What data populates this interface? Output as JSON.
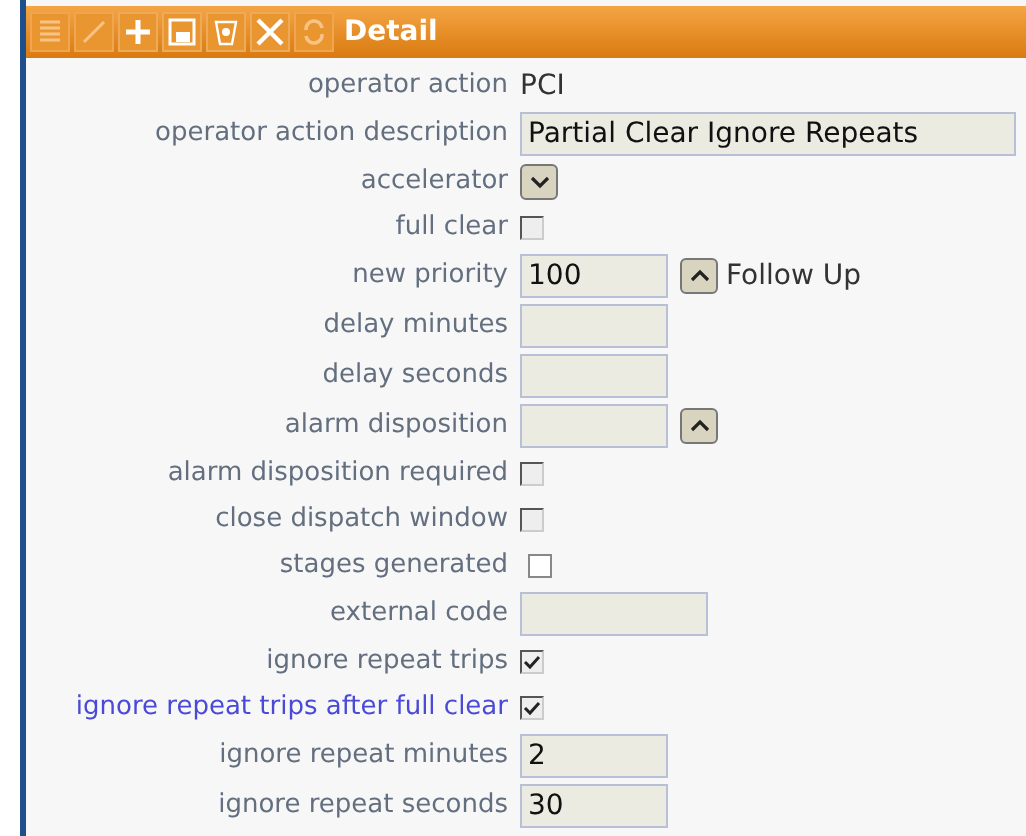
{
  "toolbar": [
    {
      "kind": "list",
      "disabled": true
    },
    {
      "kind": "edit",
      "disabled": true
    },
    {
      "kind": "add",
      "disabled": false
    },
    {
      "kind": "save",
      "disabled": false
    },
    {
      "kind": "delete",
      "disabled": false
    },
    {
      "kind": "close",
      "disabled": false
    },
    {
      "kind": "refresh",
      "disabled": true
    }
  ],
  "title": "Detail",
  "fields": [
    {
      "label": "operator action",
      "kind": "text",
      "value": "PCI"
    },
    {
      "label": "operator action description",
      "kind": "longfield",
      "value": "Partial Clear Ignore Repeats"
    },
    {
      "label": "accelerator",
      "kind": "dropdown"
    },
    {
      "label": "full clear",
      "kind": "checkbox",
      "checked": false,
      "disabled": true
    },
    {
      "label": "new priority",
      "kind": "lookup",
      "value": "100",
      "extra": "Follow Up"
    },
    {
      "label": "delay minutes",
      "kind": "field"
    },
    {
      "label": "delay seconds",
      "kind": "field"
    },
    {
      "label": "alarm disposition",
      "kind": "lookup"
    },
    {
      "label": "alarm disposition required",
      "kind": "checkbox",
      "checked": false,
      "disabled": true
    },
    {
      "label": "close dispatch window",
      "kind": "checkbox",
      "checked": false,
      "disabled": true
    },
    {
      "label": "stages generated",
      "kind": "checkbox",
      "checked": false,
      "disabled": false
    },
    {
      "label": "external code",
      "kind": "midfield"
    },
    {
      "label": "ignore repeat trips",
      "kind": "checkbox",
      "checked": true,
      "disabled": true
    },
    {
      "label": "ignore repeat trips after full clear",
      "kind": "checkbox",
      "checked": true,
      "disabled": true,
      "highlighted": true
    },
    {
      "label": "ignore repeat minutes",
      "kind": "field",
      "value": "2"
    },
    {
      "label": "ignore repeat seconds",
      "kind": "field",
      "value": "30"
    }
  ]
}
